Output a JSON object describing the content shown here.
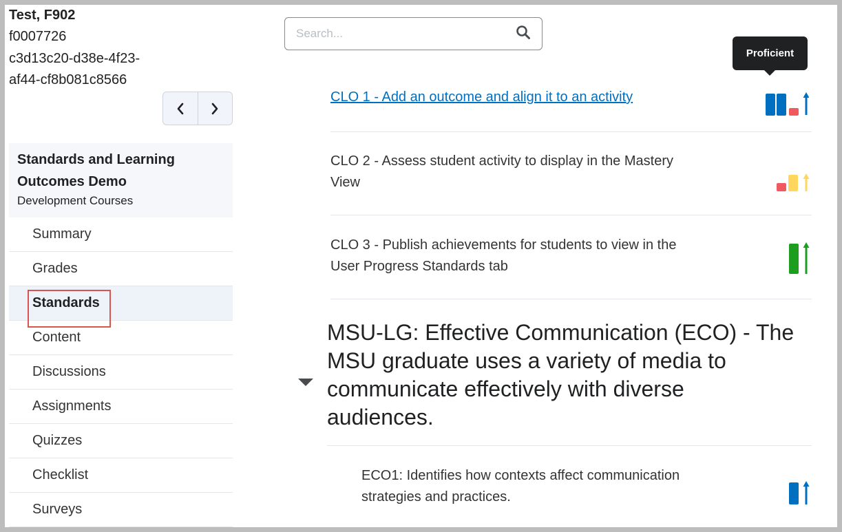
{
  "user": {
    "name": "Test, F902",
    "lines": [
      "f0007726",
      "c3d13c20-d38e-4f23-",
      "af44-cf8b081c8566"
    ]
  },
  "pager": {
    "prev_icon": "chevron-left-icon",
    "next_icon": "chevron-right-icon"
  },
  "course": {
    "title_line1": "Standards and Learning",
    "title_line2": "Outcomes Demo",
    "subtitle": "Development Courses"
  },
  "nav": {
    "items": [
      {
        "label": "Summary"
      },
      {
        "label": "Grades"
      },
      {
        "label": "Standards",
        "active": true
      },
      {
        "label": "Content"
      },
      {
        "label": "Discussions"
      },
      {
        "label": "Assignments"
      },
      {
        "label": "Quizzes"
      },
      {
        "label": "Checklist"
      },
      {
        "label": "Surveys"
      }
    ]
  },
  "search": {
    "placeholder": "Search...",
    "value": "",
    "icon": "search-icon"
  },
  "tooltip": {
    "text": "Proficient"
  },
  "outcomes": [
    {
      "line1": "CLO 1 - Add an outcome and align it to an activity",
      "line2": ""
    },
    {
      "line1": "CLO 2 - Assess student activity to display in the Mastery",
      "line2": "View"
    },
    {
      "line1": "CLO 3 - Publish achievements for students to view in the",
      "line2": "User Progress Standards tab"
    }
  ],
  "group": {
    "line1": "MSU-LG: Effective Communication (ECO) - The",
    "line2": "MSU graduate uses a variety of media to",
    "line3": "communicate effectively with diverse",
    "line4": "audiences.",
    "child": {
      "line1": "ECO1: Identifies how contexts affect communication",
      "line2": "strategies and practices."
    }
  },
  "colors": {
    "blue": "#006fbf",
    "red": "#f05a5f",
    "yellow": "#ffd75e",
    "green": "#1e9e1e",
    "highlight": "#d9534f"
  }
}
